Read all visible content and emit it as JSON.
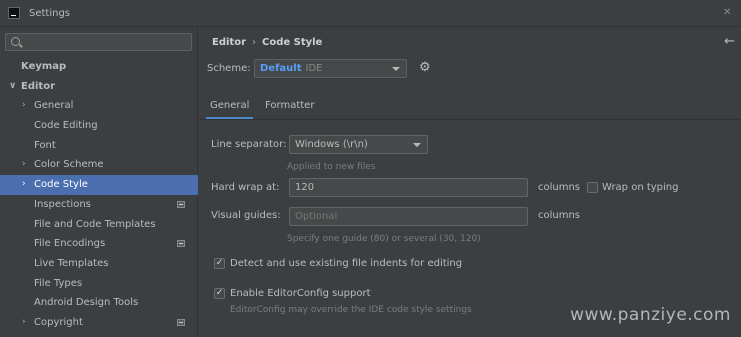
{
  "window": {
    "title": "Settings",
    "close_glyph": "✕"
  },
  "sidebar": {
    "search_placeholder": "",
    "items": [
      {
        "label": "Keymap",
        "indent": 0,
        "bold": true,
        "arrow": "",
        "selected": false,
        "project_icon": false
      },
      {
        "label": "Editor",
        "indent": 0,
        "bold": true,
        "arrow": "∨",
        "selected": false,
        "project_icon": false
      },
      {
        "label": "General",
        "indent": 1,
        "bold": false,
        "arrow": "›",
        "selected": false,
        "project_icon": false
      },
      {
        "label": "Code Editing",
        "indent": 1,
        "bold": false,
        "arrow": "",
        "selected": false,
        "project_icon": false
      },
      {
        "label": "Font",
        "indent": 1,
        "bold": false,
        "arrow": "",
        "selected": false,
        "project_icon": false
      },
      {
        "label": "Color Scheme",
        "indent": 1,
        "bold": false,
        "arrow": "›",
        "selected": false,
        "project_icon": false
      },
      {
        "label": "Code Style",
        "indent": 1,
        "bold": false,
        "arrow": "›",
        "selected": true,
        "project_icon": false
      },
      {
        "label": "Inspections",
        "indent": 1,
        "bold": false,
        "arrow": "",
        "selected": false,
        "project_icon": true
      },
      {
        "label": "File and Code Templates",
        "indent": 1,
        "bold": false,
        "arrow": "",
        "selected": false,
        "project_icon": false
      },
      {
        "label": "File Encodings",
        "indent": 1,
        "bold": false,
        "arrow": "",
        "selected": false,
        "project_icon": true
      },
      {
        "label": "Live Templates",
        "indent": 1,
        "bold": false,
        "arrow": "",
        "selected": false,
        "project_icon": false
      },
      {
        "label": "File Types",
        "indent": 1,
        "bold": false,
        "arrow": "",
        "selected": false,
        "project_icon": false
      },
      {
        "label": "Android Design Tools",
        "indent": 1,
        "bold": false,
        "arrow": "",
        "selected": false,
        "project_icon": false
      },
      {
        "label": "Copyright",
        "indent": 1,
        "bold": false,
        "arrow": "›",
        "selected": false,
        "project_icon": true
      }
    ]
  },
  "main": {
    "breadcrumb": {
      "first": "Editor",
      "separator": "›",
      "second": "Code Style"
    },
    "back_glyph": "←",
    "scheme": {
      "label": "Scheme:",
      "value_bold": "Default",
      "value_suffix": "IDE"
    },
    "gear_glyph": "⚙",
    "tabs": [
      {
        "label": "General",
        "active": true
      },
      {
        "label": "Formatter",
        "active": false
      }
    ],
    "line_separator": {
      "label": "Line separator:",
      "value": "Windows (\\r\\n)",
      "hint": "Applied to new files"
    },
    "hard_wrap": {
      "label": "Hard wrap at:",
      "value": "120",
      "unit": "columns",
      "wrap_on_typing_label": "Wrap on typing",
      "wrap_on_typing_checked": false
    },
    "visual_guides": {
      "label": "Visual guides:",
      "placeholder": "Optional",
      "unit": "columns",
      "hint": "Specify one guide (80) or several (30, 120)"
    },
    "detect_indents": {
      "label": "Detect and use existing file indents for editing",
      "checked": true
    },
    "editorconfig": {
      "label": "Enable EditorConfig support",
      "checked": true,
      "hint": "EditorConfig may override the IDE code style settings"
    }
  },
  "watermark": "www.panziye.com",
  "colors": {
    "background": "#3c3f41",
    "selection": "#4b6eaf",
    "accent": "#589df6",
    "tab_underline": "#4a88c7"
  }
}
